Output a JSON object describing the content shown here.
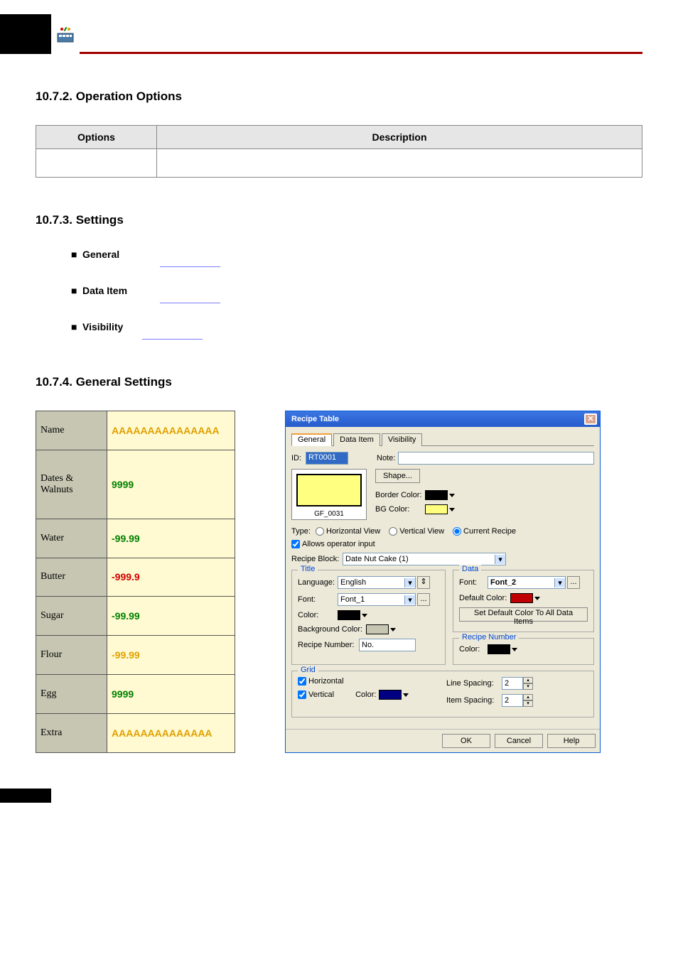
{
  "headings": {
    "h1": "10.7.2. Operation Options",
    "h2": "10.7.3. Settings",
    "h3": "10.7.4. General Settings"
  },
  "opt_table": {
    "col1": "Options",
    "col2": "Description"
  },
  "settings_bullets": [
    "General",
    "Data Item",
    "Visibility"
  ],
  "sample_rows": [
    {
      "name": "Name",
      "value": "AAAAAAAAAAAAAAA",
      "cls": "v-or"
    },
    {
      "name": "Dates & Walnuts",
      "value": "9999",
      "cls": "v-green"
    },
    {
      "name": "Water",
      "value": "-99.99",
      "cls": "v-green"
    },
    {
      "name": "Butter",
      "value": "-999.9",
      "cls": "v-red"
    },
    {
      "name": "Sugar",
      "value": "-99.99",
      "cls": "v-green"
    },
    {
      "name": "Flour",
      "value": "-99.99",
      "cls": "v-or"
    },
    {
      "name": "Egg",
      "value": "9999",
      "cls": "v-green"
    },
    {
      "name": "Extra",
      "value": "AAAAAAAAAAAAAA",
      "cls": "v-or"
    }
  ],
  "dialog": {
    "title": "Recipe Table",
    "tabs": [
      "General",
      "Data Item",
      "Visibility"
    ],
    "id_label": "ID:",
    "id_value": "RT0001",
    "note_label": "Note:",
    "preview_caption": "GF_0031",
    "shape_btn": "Shape...",
    "border_color_label": "Border Color:",
    "bg_color_label": "BG Color:",
    "type_label": "Type:",
    "type_horizontal": "Horizontal View",
    "type_vertical": "Vertical View",
    "type_current": "Current Recipe",
    "allow_input": "Allows operator input",
    "recipe_block_label": "Recipe Block:",
    "recipe_block_value": "Date Nut Cake (1)",
    "title_group": "Title",
    "language_label": "Language:",
    "language_value": "English",
    "font_label": "Font:",
    "font1": "Font_1",
    "color_label": "Color:",
    "bgcolor_label": "Background Color:",
    "recipe_num_label": "Recipe Number:",
    "recipe_num_value": "No.",
    "data_group": "Data",
    "font2": "Font_2",
    "default_color_label": "Default Color:",
    "set_default_btn": "Set Default Color To All Data Items",
    "recipe_number_group": "Recipe Number",
    "grid_group": "Grid",
    "grid_horizontal": "Horizontal",
    "grid_vertical": "Vertical",
    "line_spacing_label": "Line Spacing:",
    "line_spacing_value": "2",
    "item_spacing_label": "Item Spacing:",
    "item_spacing_value": "2",
    "ok": "OK",
    "cancel": "Cancel",
    "help": "Help"
  }
}
